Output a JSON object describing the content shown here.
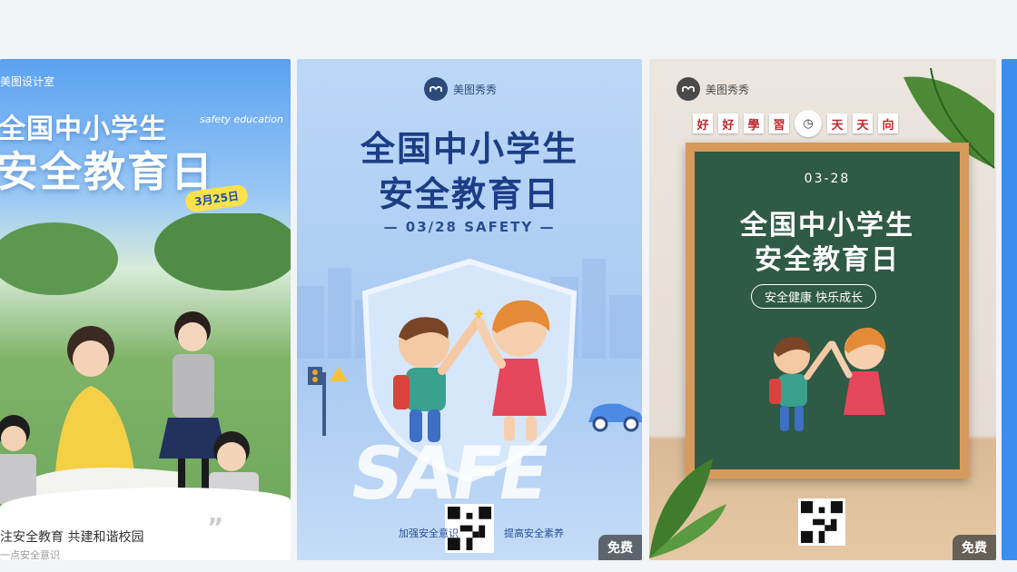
{
  "cards": [
    {
      "studio": "美图设计室",
      "title_line1": "全国中小学生",
      "title_line2": "安全教育日",
      "english": "safety education",
      "date_tag": "3月25日",
      "bottom_line1": "注安全教育  共建和谐校园",
      "bottom_line2": "一点安全意识"
    },
    {
      "brand": "美图秀秀",
      "title_line1": "全国中小学生",
      "title_line2": "安全教育日",
      "subtitle": "— 03/28 SAFETY —",
      "safe_word": "SAFE",
      "left_caption": "加强安全意识",
      "right_caption": "提高安全素养",
      "badge": "免费"
    },
    {
      "brand": "美图秀秀",
      "motto": [
        "好",
        "好",
        "學",
        "習",
        "天",
        "天",
        "向"
      ],
      "date": "03-28",
      "title_line1": "全国中小学生",
      "title_line2": "安全教育日",
      "slogan": "安全健康 快乐成长",
      "badge": "免费"
    }
  ],
  "colors": {
    "accent_blue": "#1d3d86",
    "board_green": "#2f5a45",
    "badge_bg": "#3c3c3c"
  }
}
